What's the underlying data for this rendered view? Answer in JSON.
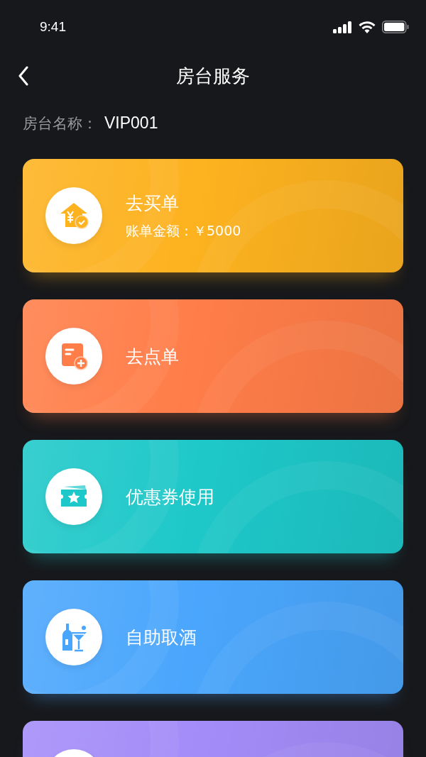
{
  "status_bar": {
    "time": "9:41"
  },
  "nav": {
    "title": "房台服务"
  },
  "room": {
    "label": "房台名称：",
    "value": "VIP001"
  },
  "services": [
    {
      "kind": "bill",
      "color": "#fdb21f",
      "title": "去买单",
      "subtitle": "账单金额：￥5000"
    },
    {
      "kind": "order",
      "color": "#ff7d48",
      "title": "去点单"
    },
    {
      "kind": "coupon",
      "color": "#1ec8c9",
      "title": "优惠券使用"
    },
    {
      "kind": "wine",
      "color": "#4aa6fc",
      "title": "自助取酒"
    },
    {
      "kind": "partial",
      "color": "#a38cf8"
    }
  ]
}
